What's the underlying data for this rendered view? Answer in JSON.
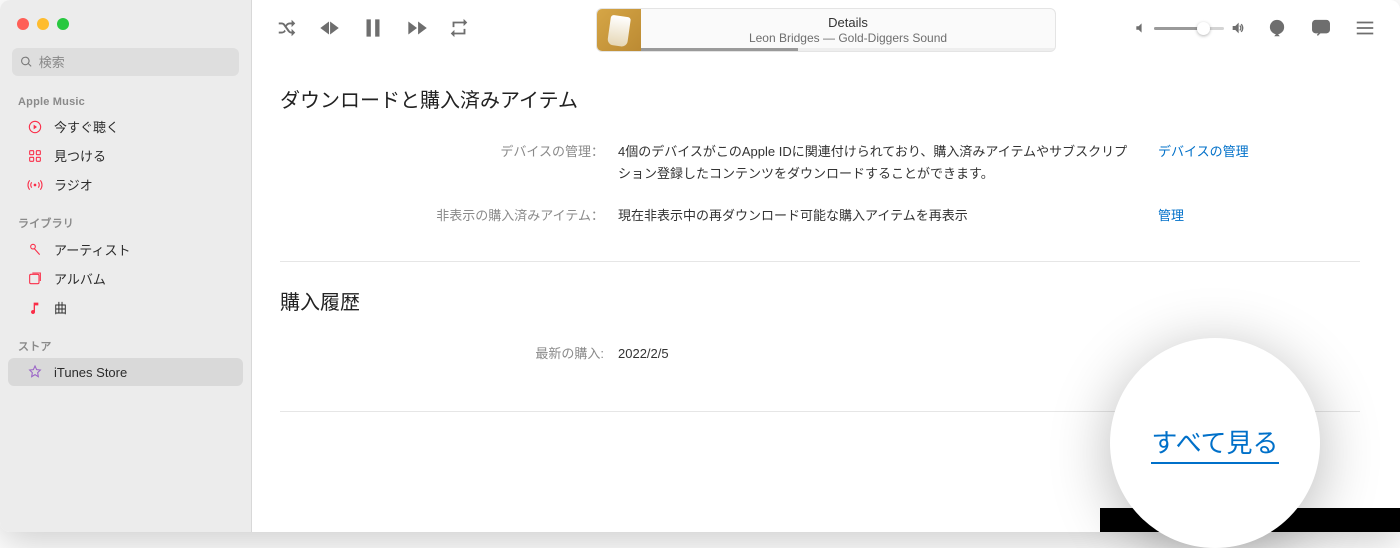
{
  "search": {
    "placeholder": "検索"
  },
  "sidebar": {
    "sections": [
      {
        "title": "Apple Music",
        "items": [
          {
            "label": "今すぐ聴く",
            "icon": "play-circle"
          },
          {
            "label": "見つける",
            "icon": "grid"
          },
          {
            "label": "ラジオ",
            "icon": "broadcast"
          }
        ]
      },
      {
        "title": "ライブラリ",
        "items": [
          {
            "label": "アーティスト",
            "icon": "mic"
          },
          {
            "label": "アルバム",
            "icon": "album"
          },
          {
            "label": "曲",
            "icon": "note"
          }
        ]
      },
      {
        "title": "ストア",
        "items": [
          {
            "label": "iTunes Store",
            "icon": "star",
            "selected": true
          }
        ]
      }
    ]
  },
  "nowplaying": {
    "title": "Details",
    "subtitle": "Leon Bridges — Gold-Diggers Sound",
    "progress_percent": 38
  },
  "volume_percent": 68,
  "content": {
    "section1": {
      "title": "ダウンロードと購入済みアイテム",
      "rows": [
        {
          "label": "デバイスの管理：",
          "value": "4個のデバイスがこのApple IDに関連付けられており、購入済みアイテムやサブスクリプション登録したコンテンツをダウンロードすることができます。",
          "link": "デバイスの管理"
        },
        {
          "label": "非表示の購入済みアイテム：",
          "value": "現在非表示中の再ダウンロード可能な購入アイテムを再表示",
          "link": "管理"
        }
      ]
    },
    "section2": {
      "title": "購入履歴",
      "rows": [
        {
          "label": "最新の購入:",
          "value": "2022/2/5"
        }
      ]
    }
  },
  "callout": {
    "label": "すべて見る"
  }
}
